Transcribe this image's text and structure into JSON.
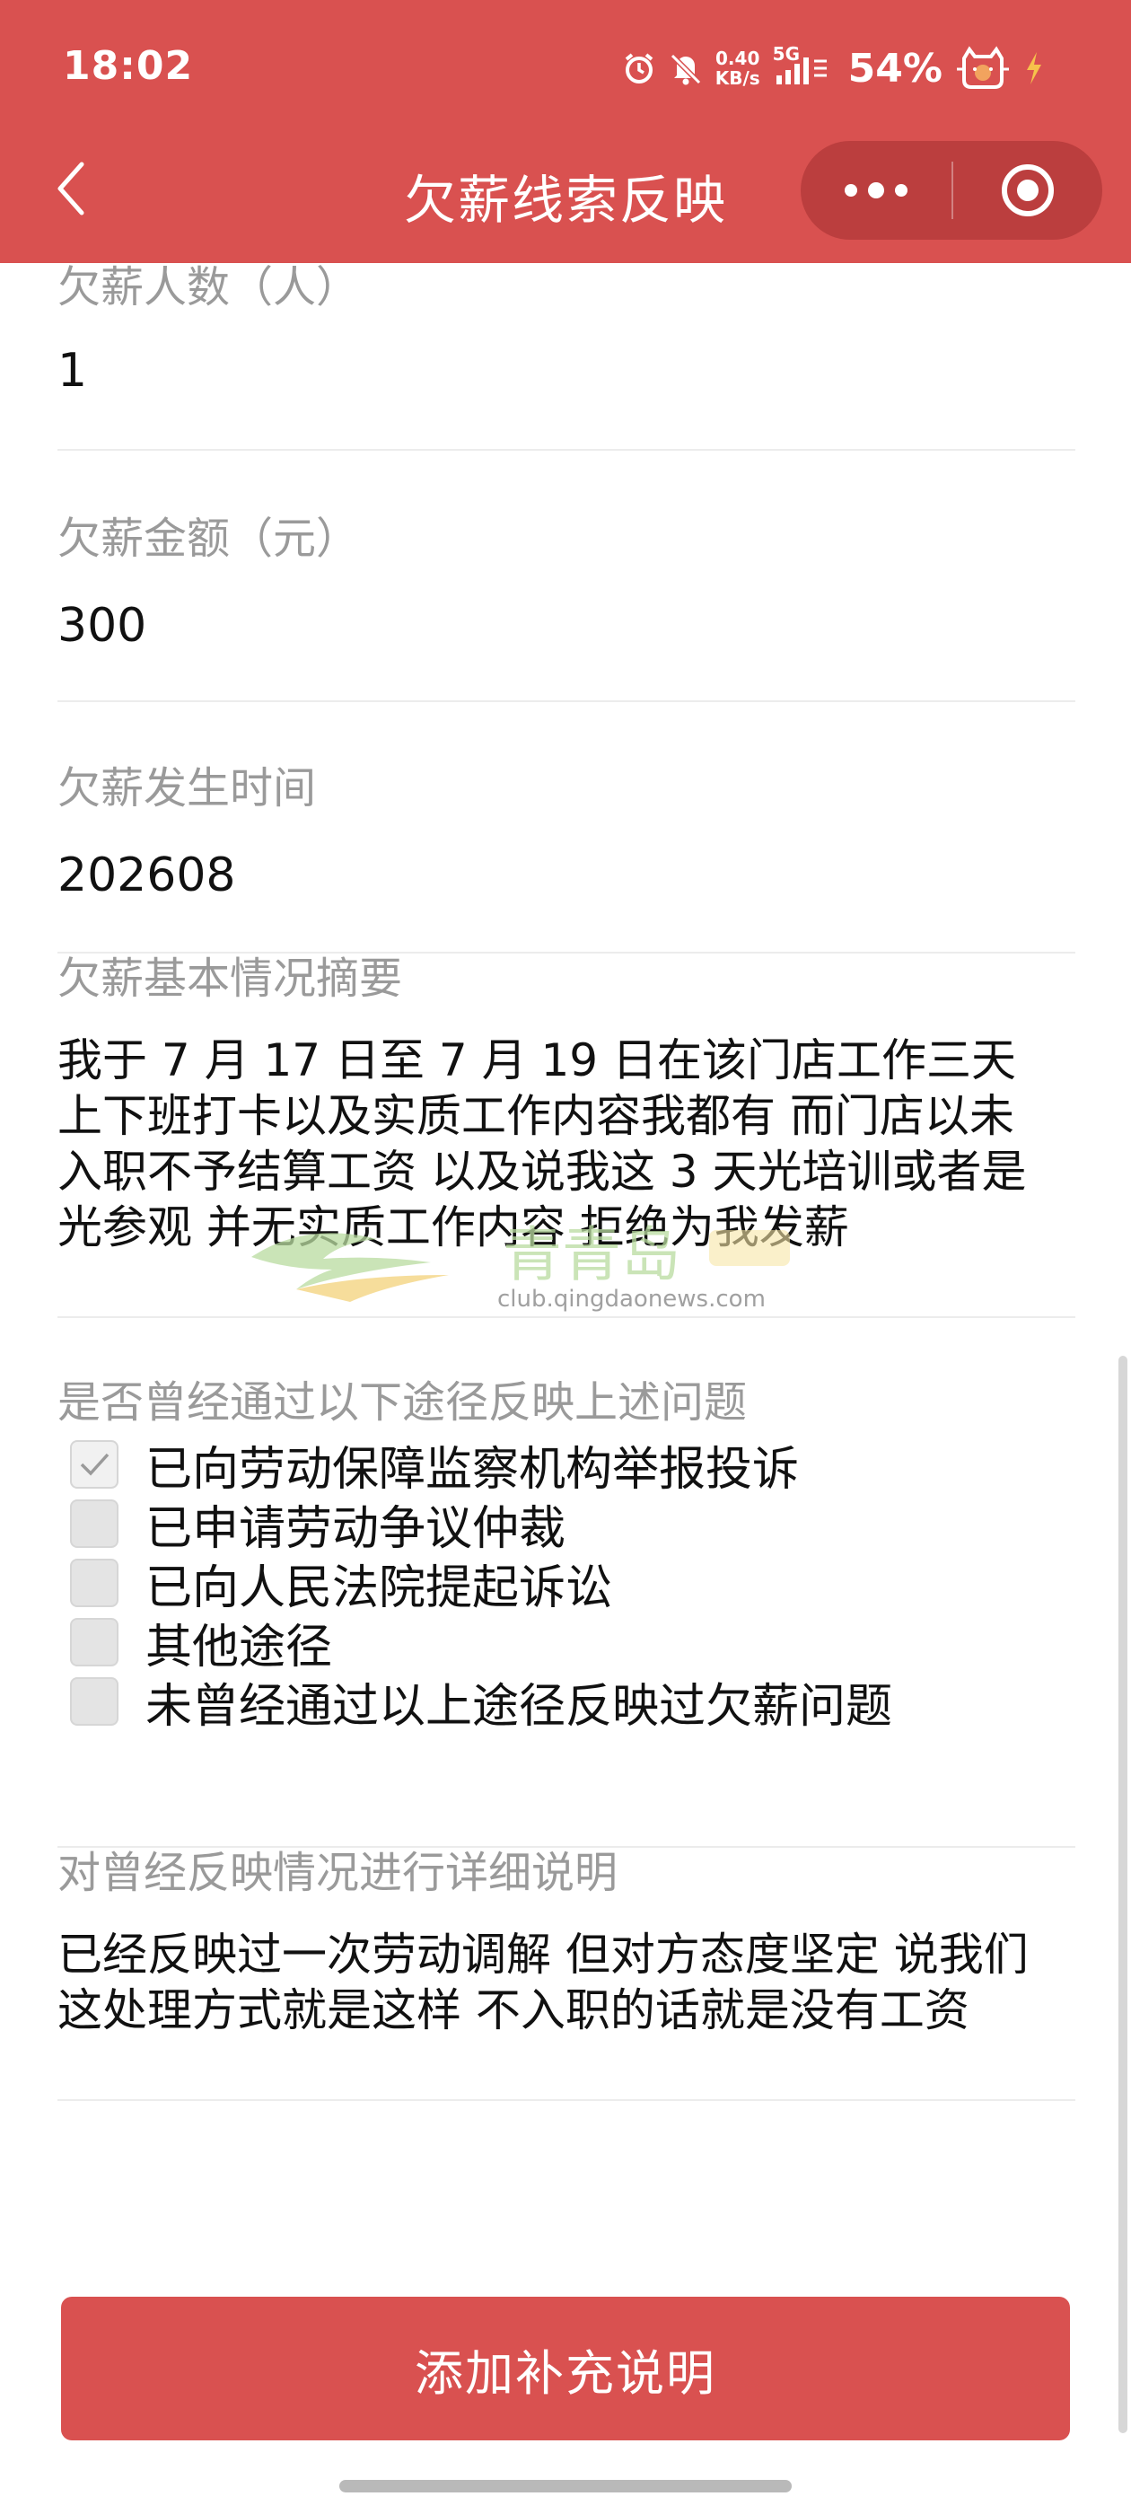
{
  "status_bar": {
    "time": "18:02",
    "speed_value": "0.40",
    "speed_unit": "KB/s",
    "network": "5G",
    "battery": "54%",
    "icons": [
      "alarm-icon",
      "mute-icon",
      "signal-icon",
      "cat-battery-icon",
      "charging-icon"
    ]
  },
  "nav": {
    "title": "欠薪线索反映",
    "back_icon": "chevron-left-icon",
    "more_icon": "more-dots-icon",
    "close_icon": "target-circle-icon"
  },
  "fields": {
    "workers_label": "欠薪人数（人）",
    "workers_value": "1",
    "amount_label": "欠薪金额（元）",
    "amount_value": "300",
    "time_label": "欠薪发生时间",
    "time_value": "202608",
    "summary_label": "欠薪基本情况摘要",
    "summary_lines": [
      "我于 7 月 17 日至 7 月 19 日在该门店工作三天",
      "上下班打卡以及实质工作内容我都有 而门店以未",
      "入职不予结算工资 以及说我这 3 天光培训或者是",
      "光参观 并无实质工作内容 拒绝为我发薪"
    ]
  },
  "channels": {
    "label": "是否曾经通过以下途径反映上述问题",
    "options": [
      {
        "label": "已向劳动保障监察机构举报投诉",
        "checked": true
      },
      {
        "label": "已申请劳动争议仲裁",
        "checked": false
      },
      {
        "label": "已向人民法院提起诉讼",
        "checked": false
      },
      {
        "label": "其他途径",
        "checked": false
      },
      {
        "label": "未曾经通过以上途径反映过欠薪问题",
        "checked": false
      }
    ]
  },
  "detail": {
    "label": "对曾经反映情况进行详细说明",
    "lines": [
      "已经反映过一次劳动调解 但对方态度坚定 说我们",
      "这处理方式就是这样 不入职的话就是没有工资"
    ]
  },
  "watermark": {
    "brand": "青青岛",
    "url": "club.qingdaonews.com"
  },
  "button": {
    "label": "添加补充说明"
  },
  "colors": {
    "brand_red": "#d95150",
    "label_gray": "#9a9a9a"
  }
}
